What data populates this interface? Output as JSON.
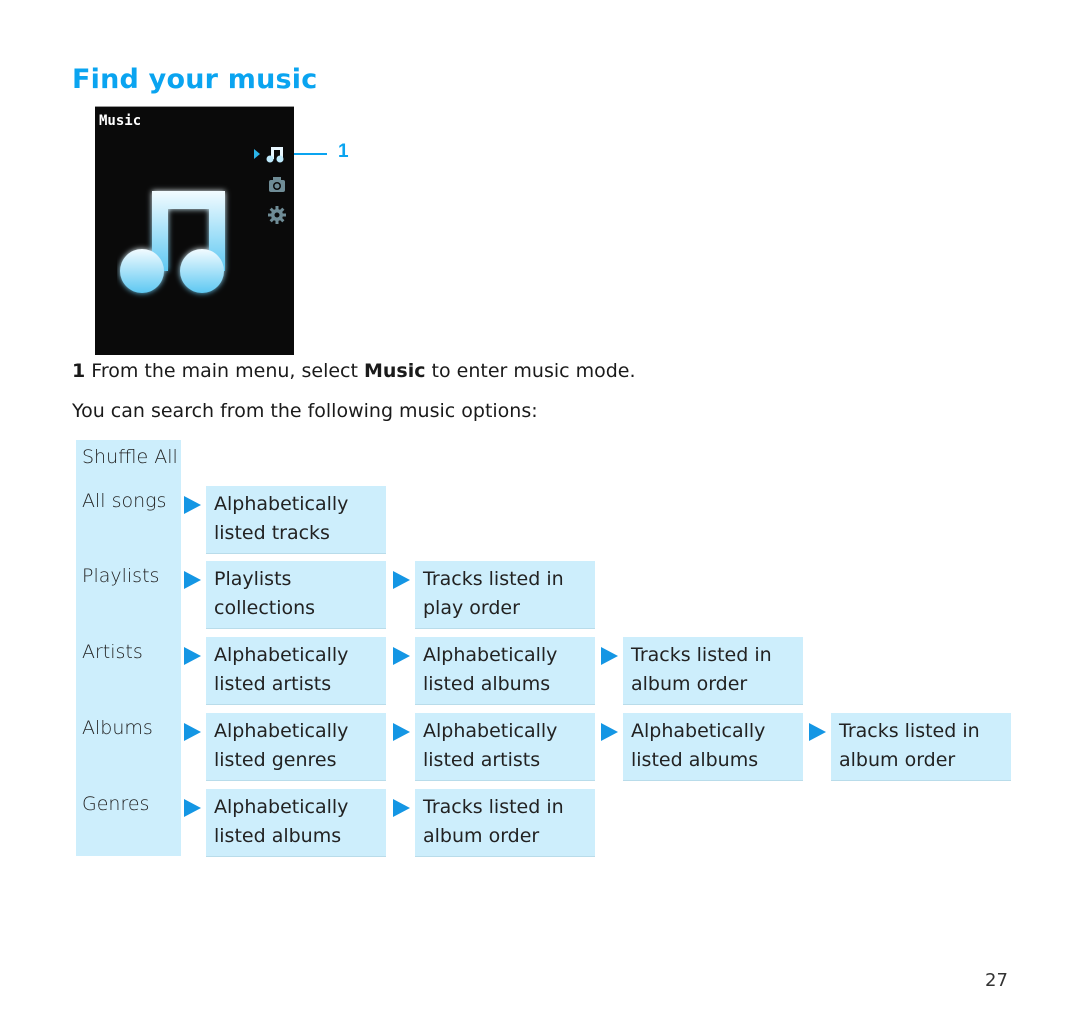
{
  "heading": "Find your music",
  "device_screen": {
    "title": "Music",
    "menu_icons": [
      "music-note-icon",
      "camera-icon",
      "gear-icon"
    ],
    "selected": "music-note-icon",
    "callout": "1"
  },
  "step": {
    "number": "1",
    "text_before": "From the main menu, select ",
    "bold": "Music",
    "text_after": " to enter music mode."
  },
  "intro": "You can search from the following music options:",
  "options": [
    {
      "category": "Shuffle All",
      "path": []
    },
    {
      "category": "All songs",
      "path": [
        "Alphabetically\nlisted tracks"
      ]
    },
    {
      "category": "Playlists",
      "path": [
        "Playlists\ncollections",
        "Tracks listed in\nplay order"
      ]
    },
    {
      "category": "Artists",
      "path": [
        "Alphabetically\nlisted artists",
        "Alphabetically\nlisted albums",
        "Tracks listed in\nalbum order"
      ]
    },
    {
      "category": "Albums",
      "path": [
        "Alphabetically\nlisted genres",
        "Alphabetically\nlisted artists",
        "Alphabetically\nlisted albums",
        "Tracks listed in\nalbum order"
      ]
    },
    {
      "category": "Genres",
      "path": [
        "Alphabetically\nlisted albums",
        "Tracks listed in\nalbum order"
      ]
    }
  ],
  "colors": {
    "accent": "#0aa4f0",
    "box_bg": "#cdeefc",
    "arrow": "#1496e4"
  },
  "page_number": "27"
}
